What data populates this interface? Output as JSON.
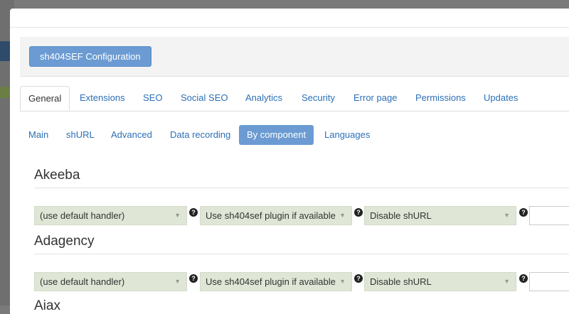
{
  "toolbar": {
    "config_button": "sh404SEF Configuration"
  },
  "tabs": [
    {
      "label": "General"
    },
    {
      "label": "Extensions"
    },
    {
      "label": "SEO"
    },
    {
      "label": "Social SEO"
    },
    {
      "label": "Analytics"
    },
    {
      "label": "Security"
    },
    {
      "label": "Error page"
    },
    {
      "label": "Permissions"
    },
    {
      "label": "Updates"
    }
  ],
  "subtabs": [
    {
      "label": "Main"
    },
    {
      "label": "shURL"
    },
    {
      "label": "Advanced"
    },
    {
      "label": "Data recording"
    },
    {
      "label": "By component"
    },
    {
      "label": "Languages"
    }
  ],
  "components": [
    {
      "name": "Akeeba",
      "handler": "(use default handler)",
      "plugin": "Use sh404sef plugin if available",
      "shurl": "Disable shURL"
    },
    {
      "name": "Adagency",
      "handler": "(use default handler)",
      "plugin": "Use sh404sef plugin if available",
      "shurl": "Disable shURL"
    },
    {
      "name": "Aiax"
    }
  ],
  "icons": {
    "help": "question-circle-icon",
    "caret": "caret-down-icon"
  },
  "help_glyph": "?",
  "caret_glyph": "▼",
  "colors": {
    "primary": "#6b9bd2",
    "select_bg": "#dfe6d6",
    "link": "#2d6fb6"
  }
}
